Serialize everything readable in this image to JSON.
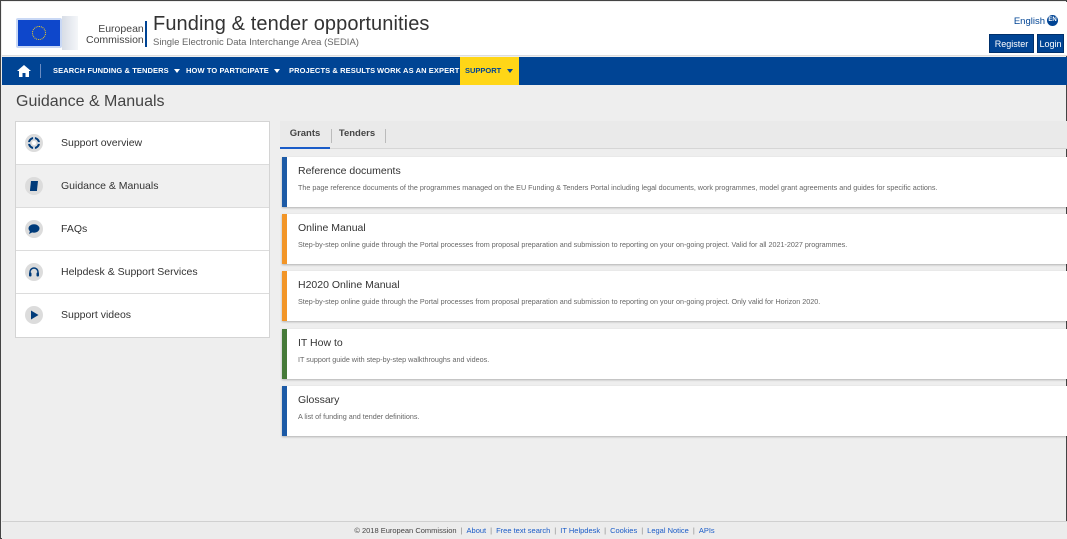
{
  "header": {
    "logo_line1": "European",
    "logo_line2": "Commission",
    "title": "Funding & tender opportunities",
    "subtitle": "Single Electronic Data Interchange Area (SEDIA)",
    "language": "English",
    "language_code": "EN",
    "register_label": "Register",
    "login_label": "Login"
  },
  "nav": {
    "home_icon": "home-icon",
    "items": [
      {
        "label": "SEARCH FUNDING & TENDERS",
        "has_dropdown": true
      },
      {
        "label": "HOW TO PARTICIPATE",
        "has_dropdown": true
      },
      {
        "label": "PROJECTS & RESULTS",
        "has_dropdown": false
      },
      {
        "label": "WORK AS AN EXPERT",
        "has_dropdown": false
      }
    ],
    "active": {
      "label": "SUPPORT",
      "has_dropdown": true
    }
  },
  "page": {
    "title": "Guidance & Manuals"
  },
  "sidebar": {
    "items": [
      {
        "label": "Support overview",
        "icon": "lifebuoy-icon",
        "active": false
      },
      {
        "label": "Guidance & Manuals",
        "icon": "book-icon",
        "active": true
      },
      {
        "label": "FAQs",
        "icon": "speech-bubble-icon",
        "active": false
      },
      {
        "label": "Helpdesk & Support Services",
        "icon": "headset-icon",
        "active": false
      },
      {
        "label": "Support videos",
        "icon": "play-icon",
        "active": false
      }
    ]
  },
  "tabs": {
    "items": [
      {
        "label": "Grants",
        "active": true
      },
      {
        "label": "Tenders",
        "active": false
      }
    ]
  },
  "cards": [
    {
      "title": "Reference documents",
      "description": "The page reference documents of the programmes managed on the EU Funding & Tenders Portal including legal documents, work programmes, model grant agreements and guides for specific actions.",
      "accent": "#1c5aa6"
    },
    {
      "title": "Online Manual",
      "description": "Step-by-step online guide through the Portal processes from proposal preparation and submission to reporting on your on-going project. Valid for all 2021-2027 programmes.",
      "accent": "#f29527"
    },
    {
      "title": "H2020 Online Manual",
      "description": "Step-by-step online guide through the Portal processes from proposal preparation and submission to reporting on your on-going project. Only valid for Horizon 2020.",
      "accent": "#f29527"
    },
    {
      "title": "IT How to",
      "description": "IT support guide with step-by-step walkthroughs and videos.",
      "accent": "#467a39"
    },
    {
      "title": "Glossary",
      "description": "A list of funding and tender definitions.",
      "accent": "#1c5aa6"
    }
  ],
  "footer": {
    "copyright": "© 2018 European Commission",
    "links": [
      "About",
      "Free text search",
      "IT Helpdesk",
      "Cookies",
      "Legal Notice",
      "APIs"
    ]
  },
  "colors": {
    "primary": "#004494",
    "support_highlight": "#ffd617",
    "tab_active": "#1a5cc8"
  }
}
